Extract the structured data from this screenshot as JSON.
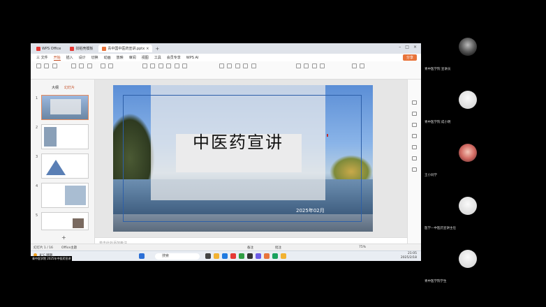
{
  "tabs": [
    {
      "label": "WPS Office"
    },
    {
      "label": "找稻壳模板"
    },
    {
      "label": "青中国中医药宣讲.pptx"
    }
  ],
  "menu": [
    "三 文件",
    "开始",
    "插入",
    "设计",
    "切换",
    "动画",
    "放映",
    "审阅",
    "视图",
    "工具",
    "会员专享",
    "WPS AI"
  ],
  "menu_active": "开始",
  "share_label": "分享",
  "panel_tabs": {
    "outline": "大纲",
    "slides": "幻灯片"
  },
  "slide_numbers": [
    "1",
    "2",
    "3",
    "4",
    "5"
  ],
  "slide": {
    "title": "中医药宣讲",
    "date": "2025年02月"
  },
  "notes_placeholder": "单击此处添加备注",
  "status": {
    "slide_count": "幻灯片 1 / 16",
    "theme": "Office主题",
    "notes": "备注",
    "comment": "批注",
    "zoom": "75%"
  },
  "taskbar": {
    "weather_temp": "8°C",
    "weather_desc": "晴朗",
    "search": "搜索",
    "time": "21:05",
    "date": "2025/2/18"
  },
  "caption": "青中医学院  2025年中医药宣讲",
  "participants": [
    {
      "name": "青中医学院  宣讲员"
    },
    {
      "name": "青中医学院 成小明"
    },
    {
      "name": "王小同学"
    },
    {
      "name": "医学—中医药宣讲主任"
    },
    {
      "name": "青中医学院学生"
    }
  ],
  "colors": {
    "accent": "#c24a20",
    "frame": "#2d5fa8"
  }
}
